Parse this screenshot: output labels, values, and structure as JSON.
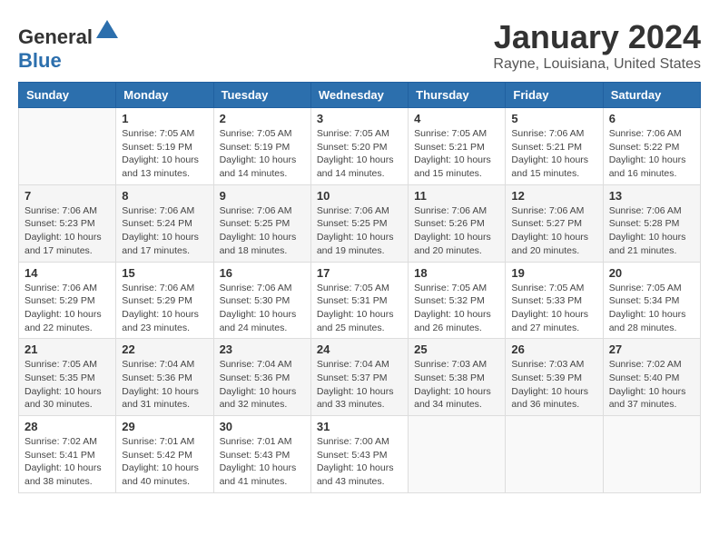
{
  "logo": {
    "general": "General",
    "blue": "Blue"
  },
  "title": "January 2024",
  "location": "Rayne, Louisiana, United States",
  "weekdays": [
    "Sunday",
    "Monday",
    "Tuesday",
    "Wednesday",
    "Thursday",
    "Friday",
    "Saturday"
  ],
  "weeks": [
    [
      {
        "day": "",
        "info": ""
      },
      {
        "day": "1",
        "info": "Sunrise: 7:05 AM\nSunset: 5:19 PM\nDaylight: 10 hours\nand 13 minutes."
      },
      {
        "day": "2",
        "info": "Sunrise: 7:05 AM\nSunset: 5:19 PM\nDaylight: 10 hours\nand 14 minutes."
      },
      {
        "day": "3",
        "info": "Sunrise: 7:05 AM\nSunset: 5:20 PM\nDaylight: 10 hours\nand 14 minutes."
      },
      {
        "day": "4",
        "info": "Sunrise: 7:05 AM\nSunset: 5:21 PM\nDaylight: 10 hours\nand 15 minutes."
      },
      {
        "day": "5",
        "info": "Sunrise: 7:06 AM\nSunset: 5:21 PM\nDaylight: 10 hours\nand 15 minutes."
      },
      {
        "day": "6",
        "info": "Sunrise: 7:06 AM\nSunset: 5:22 PM\nDaylight: 10 hours\nand 16 minutes."
      }
    ],
    [
      {
        "day": "7",
        "info": "Sunrise: 7:06 AM\nSunset: 5:23 PM\nDaylight: 10 hours\nand 17 minutes."
      },
      {
        "day": "8",
        "info": "Sunrise: 7:06 AM\nSunset: 5:24 PM\nDaylight: 10 hours\nand 17 minutes."
      },
      {
        "day": "9",
        "info": "Sunrise: 7:06 AM\nSunset: 5:25 PM\nDaylight: 10 hours\nand 18 minutes."
      },
      {
        "day": "10",
        "info": "Sunrise: 7:06 AM\nSunset: 5:25 PM\nDaylight: 10 hours\nand 19 minutes."
      },
      {
        "day": "11",
        "info": "Sunrise: 7:06 AM\nSunset: 5:26 PM\nDaylight: 10 hours\nand 20 minutes."
      },
      {
        "day": "12",
        "info": "Sunrise: 7:06 AM\nSunset: 5:27 PM\nDaylight: 10 hours\nand 20 minutes."
      },
      {
        "day": "13",
        "info": "Sunrise: 7:06 AM\nSunset: 5:28 PM\nDaylight: 10 hours\nand 21 minutes."
      }
    ],
    [
      {
        "day": "14",
        "info": "Sunrise: 7:06 AM\nSunset: 5:29 PM\nDaylight: 10 hours\nand 22 minutes."
      },
      {
        "day": "15",
        "info": "Sunrise: 7:06 AM\nSunset: 5:29 PM\nDaylight: 10 hours\nand 23 minutes."
      },
      {
        "day": "16",
        "info": "Sunrise: 7:06 AM\nSunset: 5:30 PM\nDaylight: 10 hours\nand 24 minutes."
      },
      {
        "day": "17",
        "info": "Sunrise: 7:05 AM\nSunset: 5:31 PM\nDaylight: 10 hours\nand 25 minutes."
      },
      {
        "day": "18",
        "info": "Sunrise: 7:05 AM\nSunset: 5:32 PM\nDaylight: 10 hours\nand 26 minutes."
      },
      {
        "day": "19",
        "info": "Sunrise: 7:05 AM\nSunset: 5:33 PM\nDaylight: 10 hours\nand 27 minutes."
      },
      {
        "day": "20",
        "info": "Sunrise: 7:05 AM\nSunset: 5:34 PM\nDaylight: 10 hours\nand 28 minutes."
      }
    ],
    [
      {
        "day": "21",
        "info": "Sunrise: 7:05 AM\nSunset: 5:35 PM\nDaylight: 10 hours\nand 30 minutes."
      },
      {
        "day": "22",
        "info": "Sunrise: 7:04 AM\nSunset: 5:36 PM\nDaylight: 10 hours\nand 31 minutes."
      },
      {
        "day": "23",
        "info": "Sunrise: 7:04 AM\nSunset: 5:36 PM\nDaylight: 10 hours\nand 32 minutes."
      },
      {
        "day": "24",
        "info": "Sunrise: 7:04 AM\nSunset: 5:37 PM\nDaylight: 10 hours\nand 33 minutes."
      },
      {
        "day": "25",
        "info": "Sunrise: 7:03 AM\nSunset: 5:38 PM\nDaylight: 10 hours\nand 34 minutes."
      },
      {
        "day": "26",
        "info": "Sunrise: 7:03 AM\nSunset: 5:39 PM\nDaylight: 10 hours\nand 36 minutes."
      },
      {
        "day": "27",
        "info": "Sunrise: 7:02 AM\nSunset: 5:40 PM\nDaylight: 10 hours\nand 37 minutes."
      }
    ],
    [
      {
        "day": "28",
        "info": "Sunrise: 7:02 AM\nSunset: 5:41 PM\nDaylight: 10 hours\nand 38 minutes."
      },
      {
        "day": "29",
        "info": "Sunrise: 7:01 AM\nSunset: 5:42 PM\nDaylight: 10 hours\nand 40 minutes."
      },
      {
        "day": "30",
        "info": "Sunrise: 7:01 AM\nSunset: 5:43 PM\nDaylight: 10 hours\nand 41 minutes."
      },
      {
        "day": "31",
        "info": "Sunrise: 7:00 AM\nSunset: 5:43 PM\nDaylight: 10 hours\nand 43 minutes."
      },
      {
        "day": "",
        "info": ""
      },
      {
        "day": "",
        "info": ""
      },
      {
        "day": "",
        "info": ""
      }
    ]
  ]
}
